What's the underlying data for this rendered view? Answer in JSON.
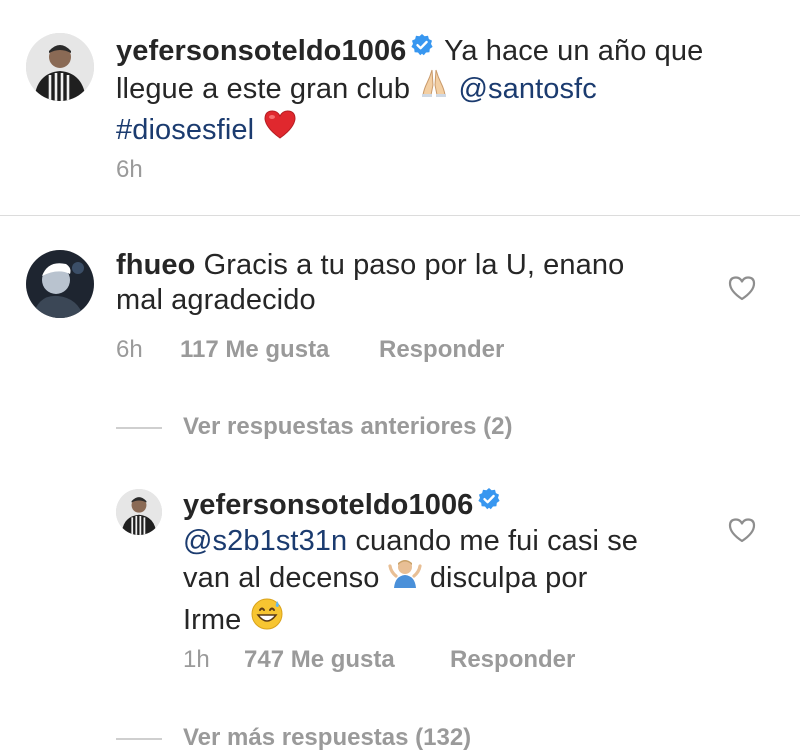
{
  "post": {
    "username": "yefersonsoteldo1006",
    "caption_line1": "Ya hace un año que",
    "caption_line2_text": "llegue a este gran club",
    "caption_line2_mention": "@santosfc",
    "caption_line3_hashtag": "#diosesfiel",
    "time": "6h",
    "emoji_pray": "pray-emoji",
    "emoji_heart": "red-heart-emoji"
  },
  "comment1": {
    "username": "fhueo",
    "text_line1": "Gracis a tu paso por la U, enano",
    "text_line2": "mal agradecido",
    "time": "6h",
    "likes": "117 Me gusta",
    "reply_label": "Responder"
  },
  "view_previous": "Ver respuestas anteriores (2)",
  "reply": {
    "username": "yefersonsoteldo1006",
    "mention": "@s2b1st31n",
    "text_line1": "cuando me fui casi se",
    "text_line2a": "van al decenso",
    "text_line2b": "disculpa por",
    "text_line3": "Irme",
    "time": "1h",
    "likes": "747 Me gusta",
    "reply_label": "Responder",
    "emoji_shrug": "person-shrugging-emoji",
    "emoji_sweat": "grinning-sweat-emoji"
  },
  "view_more": "Ver más respuestas (132)",
  "colors": {
    "text": "#262626",
    "muted": "#9a9a9a",
    "link": "#1b3b6f",
    "verified": "#3897f0",
    "heart": "#ed4956"
  }
}
